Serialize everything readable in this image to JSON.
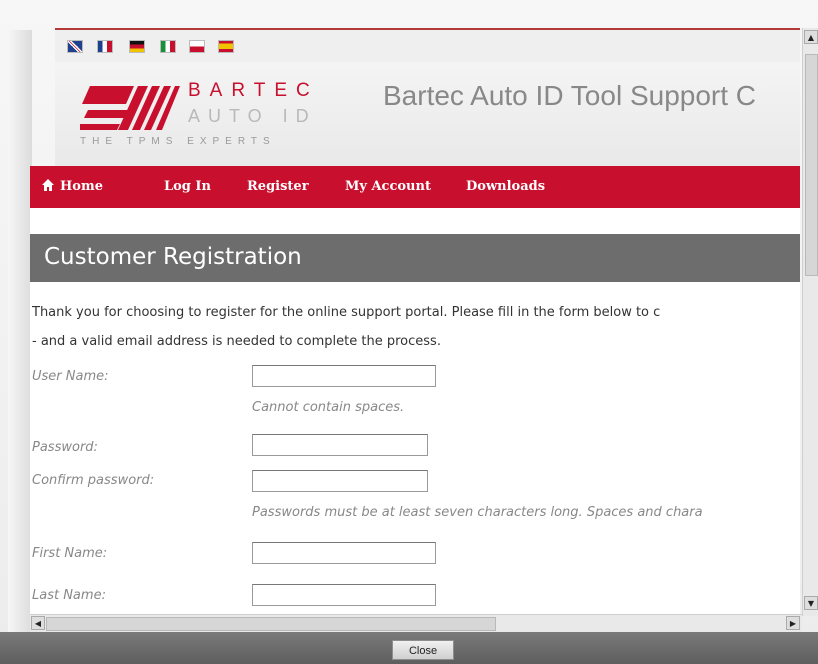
{
  "flags": [
    {
      "name": "uk-flag-icon",
      "colors": [
        "#1f3f8f",
        "#c8102e"
      ]
    },
    {
      "name": "france-flag-icon",
      "colors": [
        "#1f3f8f",
        "#ffffff",
        "#c8102e"
      ]
    },
    {
      "name": "germany-flag-icon",
      "colors": [
        "#111111",
        "#c8102e",
        "#f2c400"
      ]
    },
    {
      "name": "italy-flag-icon",
      "colors": [
        "#1a8f3a",
        "#ffffff",
        "#c8102e"
      ]
    },
    {
      "name": "poland-flag-icon",
      "colors": [
        "#ffffff",
        "#c8102e"
      ]
    },
    {
      "name": "spain-flag-icon",
      "colors": [
        "#c8102e",
        "#f2c400",
        "#c8102e"
      ]
    }
  ],
  "header": {
    "brand": "BARTEC",
    "product": "AUTO ID",
    "tagline": "THE TPMS EXPERTS",
    "site_title": "Bartec Auto ID Tool Support C"
  },
  "nav": {
    "home": "Home",
    "login": "Log In",
    "register": "Register",
    "my_account": "My Account",
    "downloads": "Downloads"
  },
  "page": {
    "title": "Customer Registration",
    "intro_line1": "Thank you for choosing to register for the online support portal. Please fill in the form below to c",
    "intro_line2": "- and a valid email address is needed to complete the process."
  },
  "form": {
    "username_label": "User Name:",
    "username_hint": "Cannot contain spaces.",
    "password_label": "Password:",
    "confirm_label": "Confirm password:",
    "password_hint": "Passwords must be at least seven characters long. Spaces and chara",
    "firstname_label": "First Name:",
    "lastname_label": "Last Name:"
  },
  "footer": {
    "close_label": "Close"
  },
  "colors": {
    "accent": "#c8102e",
    "title_bar": "#6d6d6d"
  }
}
